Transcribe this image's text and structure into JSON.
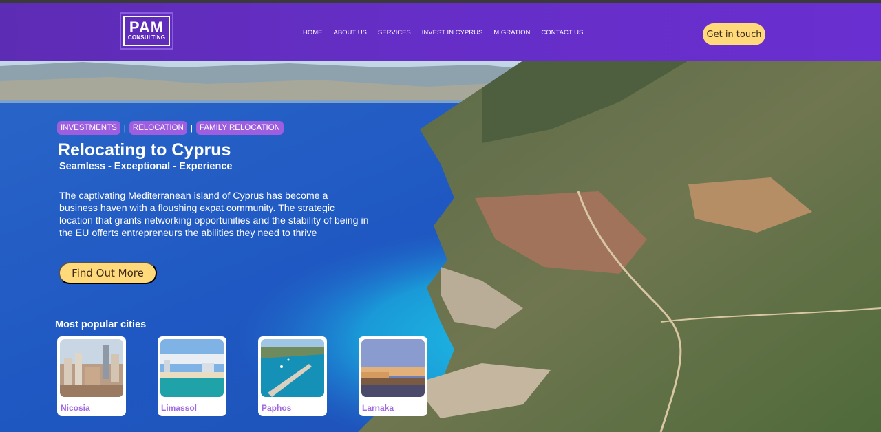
{
  "brand": {
    "logo_main": "PAM",
    "logo_sub": "CONSULTING"
  },
  "nav": {
    "items": [
      "HOME",
      "ABOUT US",
      "SERVICES",
      "INVEST IN CYPRUS",
      "MIGRATION",
      "CONTACT US"
    ]
  },
  "header": {
    "cta_label": "Get in touch"
  },
  "hero": {
    "tags": [
      "INVESTMENTS",
      "RELOCATION",
      "FAMILY RELOCATION"
    ],
    "tag_separator": "|",
    "title": "Relocating to Cyprus",
    "subtitle": "Seamless - Exceptional - Experience",
    "description": "The captivating Mediterranean island of Cyprus has become a business haven with a floushing expat community. The strategic location that grants networking opportunities and the stability of being in the EU offerts entrepreneurs the abilities they need to thrive",
    "cta_label": "Find Out More"
  },
  "cities": {
    "heading": "Most popular cities",
    "items": [
      {
        "name": "Nicosia"
      },
      {
        "name": "Limassol"
      },
      {
        "name": "Paphos"
      },
      {
        "name": "Larnaka"
      }
    ]
  },
  "colors": {
    "header_purple": "#652ec6",
    "accent_yellow": "#ffd97a",
    "tag_purple": "#9d5fe0",
    "city_label_purple": "#a06be0"
  }
}
